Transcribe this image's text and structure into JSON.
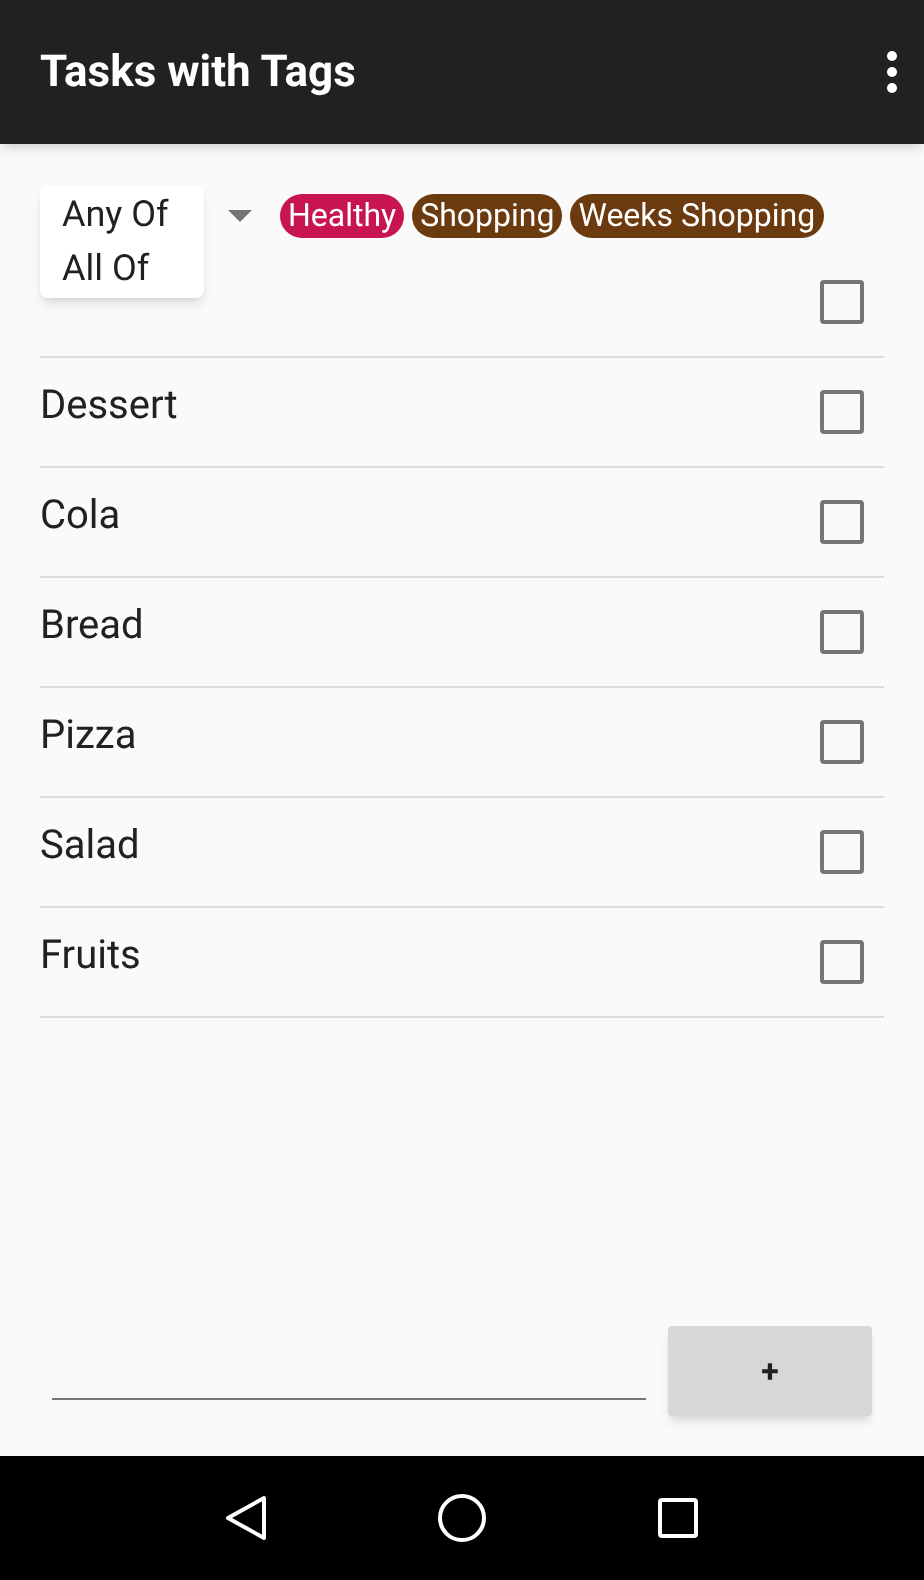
{
  "app_bar": {
    "title": "Tasks with Tags"
  },
  "filter": {
    "options": [
      "Any Of",
      "All Of"
    ]
  },
  "tags": [
    {
      "label": "Healthy",
      "color": "#c8154f"
    },
    {
      "label": "Shopping",
      "color": "#6b3a0e"
    },
    {
      "label": "Weeks Shopping",
      "color": "#6b3a0e"
    }
  ],
  "tasks": [
    {
      "checked": false
    },
    {
      "name": "Dessert",
      "checked": false
    },
    {
      "name": "Cola",
      "checked": false
    },
    {
      "name": "Bread",
      "checked": false
    },
    {
      "name": "Pizza",
      "checked": false
    },
    {
      "name": "Salad",
      "checked": false
    },
    {
      "name": "Fruits",
      "checked": false
    }
  ],
  "add_button": {
    "label": "+"
  }
}
